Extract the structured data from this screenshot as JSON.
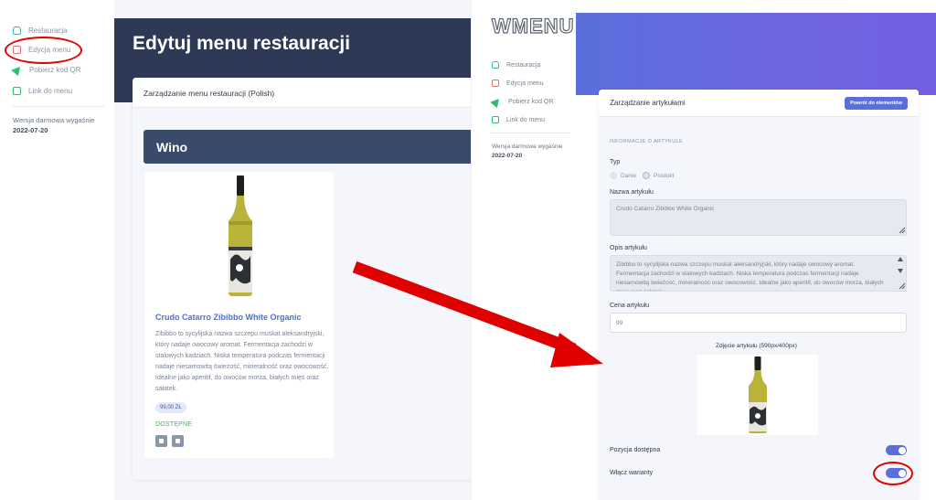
{
  "left_app": {
    "sidebar": {
      "items": [
        {
          "label": "Restauracja",
          "icon": "database-icon"
        },
        {
          "label": "Edycja menu",
          "icon": "edit-icon"
        },
        {
          "label": "Pobierz kod QR",
          "icon": "send-icon"
        },
        {
          "label": "Link do menu",
          "icon": "link-icon"
        }
      ],
      "version_text": "Wersja darmowa wygaśnie",
      "version_date": "2022-07-20"
    },
    "page_title": "Edytuj menu restauracji",
    "card_title": "Zarządzanie menu restauracji (Polish)",
    "category": "Wino",
    "product": {
      "name": "Crudo Catarro Zibibbo White Organic",
      "description": "Zibibbo to sycylijska nazwa szczepu muskat aleksandryjski, który nadaje owocowy aromat. Fermentacja zachodzi w stalowych kadziach. Niska temperatura podczas fermentacji nadaje niesamowitą świeżość, mineralność oraz owocowość. Idealne jako aperitif, do owoców morza, białych mięs oraz sałatek.",
      "price": "99,00 ZŁ",
      "status": "DOSTĘPNE"
    }
  },
  "right_app": {
    "logo": "WMENU",
    "sidebar": {
      "items": [
        {
          "label": "Restauracja",
          "icon": "database-icon"
        },
        {
          "label": "Edycja menu",
          "icon": "edit-icon"
        },
        {
          "label": "Pobierz kod QR",
          "icon": "send-icon"
        },
        {
          "label": "Link do menu",
          "icon": "link-icon"
        }
      ],
      "version_text": "Wersja darmowa wygaśnie",
      "version_date": "2022-07-20"
    },
    "panel_title": "Zarządzanie artykułami",
    "back_button": "Powrót do elementów",
    "section_label": "INFORMACJE O ARTYKULE",
    "type_label": "Typ",
    "type_options": [
      "Danie",
      "Produkt"
    ],
    "type_selected": "Produkt",
    "name_label": "Nazwa artykułu",
    "name_value": "Crudo Catarro Zibibbo White Organic",
    "desc_label": "Opis artykułu",
    "desc_value": "Zibibbo to sycylijska nazwa szczepu muskat aleksandryjski, który nadaje owocowy aromat. Fermentacja zachodzi w stalowych kadziach. Niska temperatura podczas fermentacji nadaje niesamowitą świeżość, mineralność oraz owocowość. Idealne jako aperitif, do owoców morza, białych mięs oraz sałatek.",
    "price_label": "Cena artykułu",
    "price_value": "99",
    "image_caption": "Zdjęcie artykułu (590px/400px)",
    "available_label": "Pozycja dostępna",
    "available_on": true,
    "variants_label": "Włącz warianty",
    "variants_on": true
  },
  "colors": {
    "accent": "#5a6fdc",
    "header_dark": "#2e3a55",
    "annotation_red": "#e10000",
    "link_blue": "#4a72d9",
    "available_green": "#2bbf6a"
  }
}
